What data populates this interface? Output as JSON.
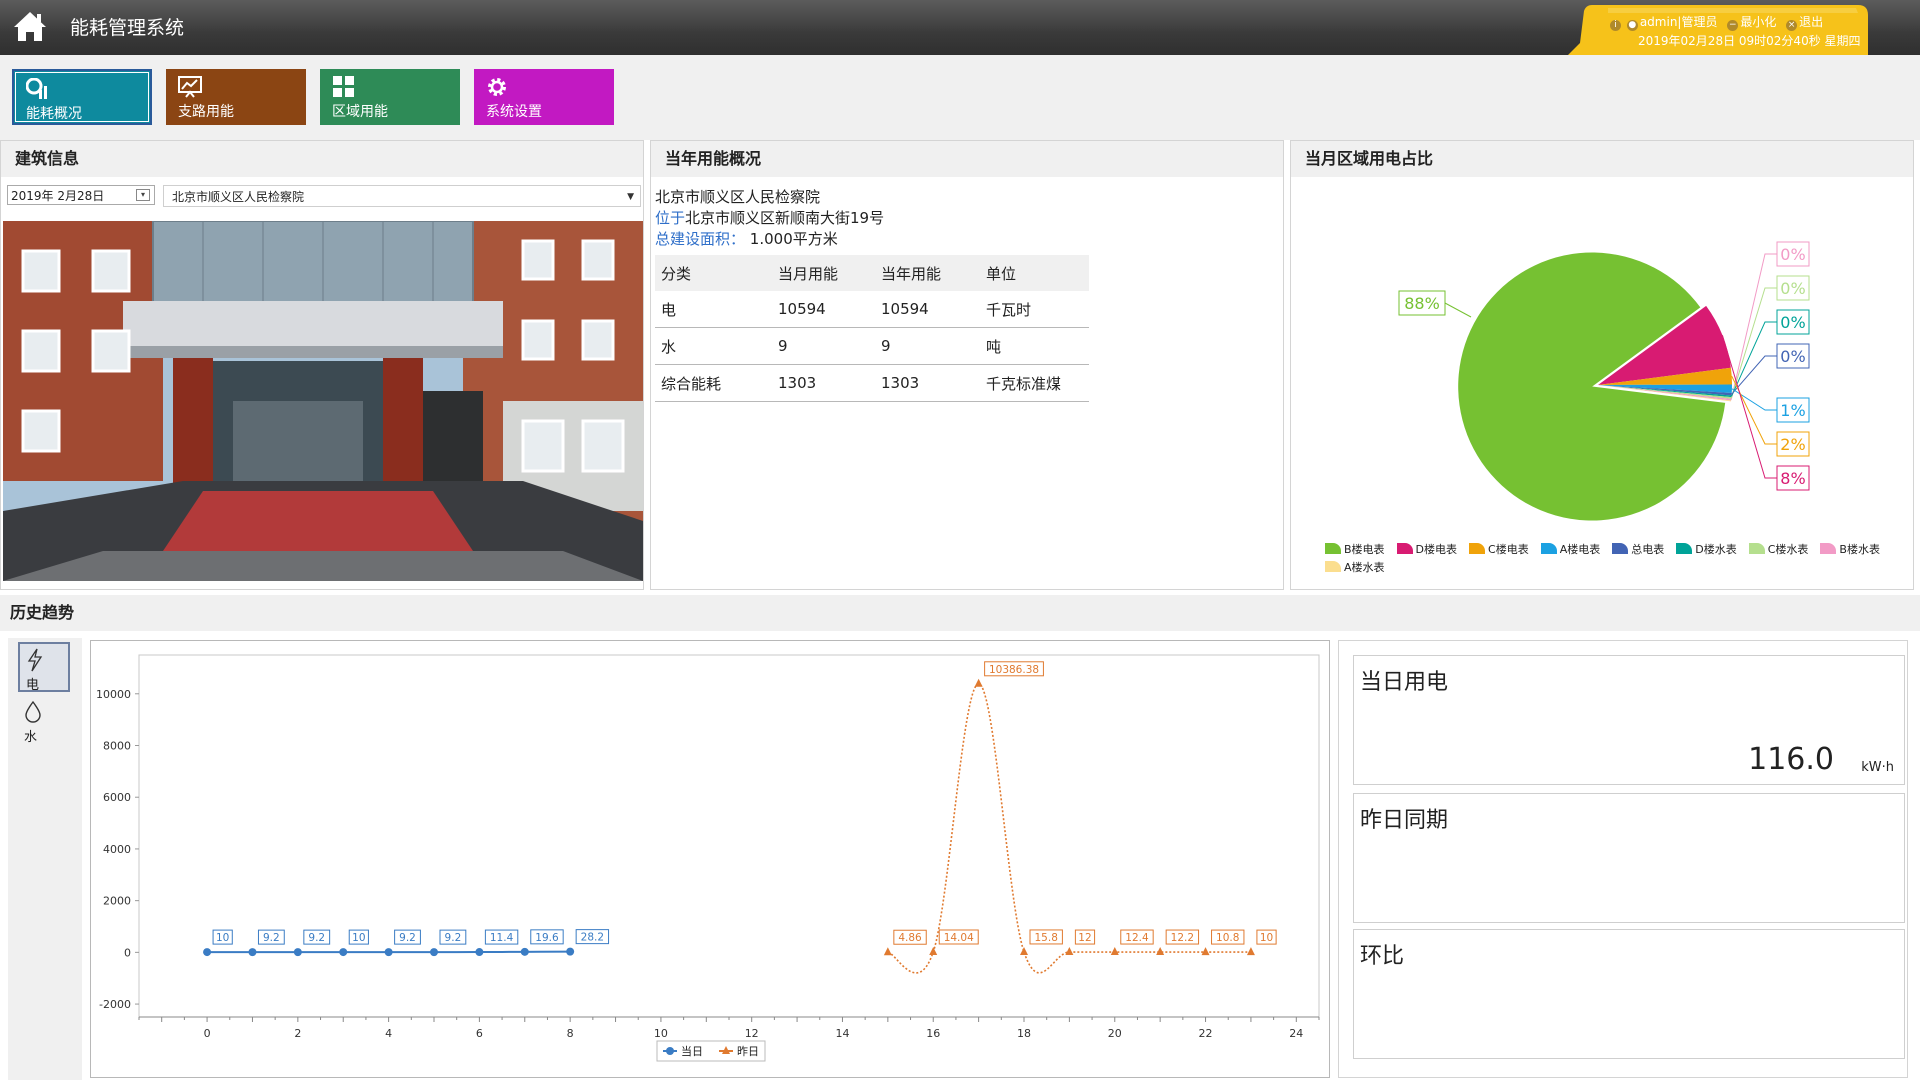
{
  "app": {
    "title": "能耗管理系统"
  },
  "user": {
    "name": "admin|管理员",
    "minimize_label": "最小化",
    "logout_label": "退出",
    "datetime": "2019年02月28日 09时02分40秒 星期四"
  },
  "nav": [
    {
      "label": "能耗概况",
      "color": "#0e8a9e",
      "icon": "overview-chart-icon",
      "active": true
    },
    {
      "label": "支路用能",
      "color": "#8b4513",
      "icon": "branch-chart-icon",
      "active": false
    },
    {
      "label": "区域用能",
      "color": "#2e8b57",
      "icon": "grid-icon",
      "active": false
    },
    {
      "label": "系统设置",
      "color": "#c219c2",
      "icon": "gear-icon",
      "active": false
    }
  ],
  "building_panel": {
    "title": "建筑信息",
    "date": "2019年 2月28日",
    "building": "北京市顺义区人民检察院"
  },
  "usage_panel": {
    "title": "当年用能概况",
    "name": "北京市顺义区人民检察院",
    "location_label": "位于",
    "location": "北京市顺义区新顺南大街19号",
    "area_label": "总建设面积：",
    "area": "1.000平方米",
    "columns": [
      "分类",
      "当月用能",
      "当年用能",
      "单位"
    ],
    "rows": [
      [
        "电",
        "10594",
        "10594",
        "千瓦时"
      ],
      [
        "水",
        "9",
        "9",
        "吨"
      ],
      [
        "综合能耗",
        "1303",
        "1303",
        "千克标准煤"
      ]
    ]
  },
  "pie_panel": {
    "title": "当月区域用电占比",
    "slices": [
      {
        "name": "B楼电表",
        "value": 88,
        "label": "88%",
        "color": "#76c132"
      },
      {
        "name": "D楼电表",
        "value": 8,
        "label": "8%",
        "color": "#d81b72"
      },
      {
        "name": "C楼电表",
        "value": 2,
        "label": "2%",
        "color": "#f0a30a"
      },
      {
        "name": "A楼电表",
        "value": 1,
        "label": "1%",
        "color": "#1ba1e2"
      },
      {
        "name": "总电表",
        "value": 0.3,
        "label": "0%",
        "color": "#4264b4"
      },
      {
        "name": "D楼水表",
        "value": 0.2,
        "label": "0%",
        "color": "#00a398"
      },
      {
        "name": "C楼水表",
        "value": 0.2,
        "label": "0%",
        "color": "#b5df8e"
      },
      {
        "name": "B楼水表",
        "value": 0.2,
        "label": "0%",
        "color": "#f29bc6"
      },
      {
        "name": "A楼水表",
        "value": 0.1,
        "label": "",
        "color": "#fbde8f"
      }
    ]
  },
  "history": {
    "title": "历史趋势",
    "types": [
      {
        "label": "电",
        "icon": "lightning-icon",
        "active": true
      },
      {
        "label": "水",
        "icon": "water-drop-icon",
        "active": false
      }
    ]
  },
  "chart_data": {
    "type": "line",
    "xlim": [
      -1.5,
      24.5
    ],
    "ylim": [
      -2500,
      11500
    ],
    "xticks": [
      0,
      2,
      4,
      6,
      8,
      10,
      12,
      14,
      16,
      18,
      20,
      22,
      24
    ],
    "yticks": [
      -2000,
      0,
      2000,
      4000,
      6000,
      8000,
      10000
    ],
    "series": [
      {
        "name": "当日",
        "color": "#3a7cc4",
        "x": [
          0,
          1,
          2,
          3,
          4,
          5,
          6,
          7,
          8
        ],
        "y": [
          10,
          9.2,
          9.2,
          10,
          9.2,
          9.2,
          11.4,
          19.6,
          28.2
        ],
        "labels": [
          "10",
          "9.2",
          "9.2",
          "10",
          "9.2",
          "9.2",
          "11.4",
          "19.6",
          "28.2"
        ]
      },
      {
        "name": "昨日",
        "color": "#e07a30",
        "x": [
          15,
          16,
          17,
          18,
          19,
          20,
          21,
          22,
          23
        ],
        "y": [
          4.86,
          14.04,
          10386.38,
          15.8,
          12,
          12.4,
          12.2,
          10.8,
          10
        ],
        "labels": [
          "4.86",
          "14.04",
          "10386.38",
          "15.8",
          "12",
          "12.4",
          "12.2",
          "10.8",
          "10"
        ]
      }
    ]
  },
  "stats": {
    "today_label": "当日用电",
    "today_value": "116.0",
    "today_unit": "kW·h",
    "yesterday_label": "昨日同期",
    "ring_label": "环比"
  }
}
